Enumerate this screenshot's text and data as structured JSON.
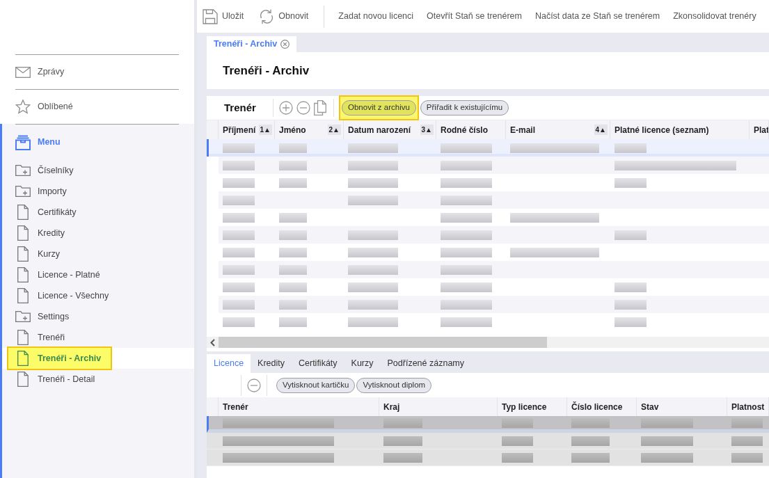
{
  "toolbar": {
    "actions": [
      {
        "kind": "save",
        "label": "Uložit"
      },
      {
        "kind": "refresh",
        "label": "Obnovit"
      }
    ],
    "links": [
      "Zadat novou licenci",
      "Otevřít Staň se trenérem",
      "Načíst data ze Staň se trenérem",
      "Zkonsolidovat trenéry"
    ]
  },
  "sidebar": {
    "top_items": [
      {
        "kind": "mail",
        "label": "Zprávy"
      },
      {
        "kind": "star",
        "label": "Oblíbené"
      }
    ],
    "menu": {
      "label": "Menu",
      "items": [
        {
          "kind": "folder",
          "label": "Číselníky",
          "selected": false,
          "highlighted": false
        },
        {
          "kind": "folder",
          "label": "Importy",
          "selected": false,
          "highlighted": false
        },
        {
          "kind": "document",
          "label": "Certifikáty",
          "selected": false,
          "highlighted": false
        },
        {
          "kind": "document",
          "label": "Kredity",
          "selected": false,
          "highlighted": false
        },
        {
          "kind": "document",
          "label": "Kurzy",
          "selected": false,
          "highlighted": false
        },
        {
          "kind": "document",
          "label": "Licence - Platné",
          "selected": false,
          "highlighted": false
        },
        {
          "kind": "document",
          "label": "Licence - Všechny",
          "selected": false,
          "highlighted": false
        },
        {
          "kind": "folder",
          "label": "Settings",
          "selected": false,
          "highlighted": false
        },
        {
          "kind": "document",
          "label": "Trenéři",
          "selected": false,
          "highlighted": false
        },
        {
          "kind": "document",
          "label": "Trenéři - Archiv",
          "selected": true,
          "highlighted": true
        },
        {
          "kind": "document",
          "label": "Trenéři - Detail",
          "selected": false,
          "highlighted": false
        }
      ]
    }
  },
  "document_tabs": [
    {
      "label": "Trenéři - Archiv",
      "selected": true
    }
  ],
  "page_title": "Trenéři - Archiv",
  "master_grid": {
    "title": "Trenér",
    "buttons": [
      {
        "label": "Obnovit z archivu",
        "highlighted": true
      },
      {
        "label": "Přiřadit k existujícímu",
        "highlighted": false
      }
    ],
    "columns": [
      {
        "label": "Příjmení",
        "sort_badge": "1▲"
      },
      {
        "label": "Jméno",
        "sort_badge": "2▲"
      },
      {
        "label": "Datum narození",
        "sort_badge": "3▲"
      },
      {
        "label": "Rodné číslo"
      },
      {
        "label": "E-mail",
        "sort_badge": "4▲"
      },
      {
        "label": "Platné licence (seznam)"
      },
      {
        "label": "Plat"
      }
    ],
    "rows": [
      {
        "selected": true,
        "cells": [
          {
            "kind": "blurred"
          },
          {
            "kind": "blurred"
          },
          {
            "kind": "blurred"
          },
          {
            "kind": "blurred"
          },
          {
            "kind": "blurred"
          },
          {
            "kind": "blurred"
          },
          {
            "kind": "blank"
          }
        ]
      },
      {
        "selected": false,
        "cells": [
          {
            "kind": "blurred"
          },
          {
            "kind": "blurred"
          },
          {
            "kind": "blurred"
          },
          {
            "kind": "blurred"
          },
          {
            "kind": "blank"
          },
          {
            "kind": "blurred_long"
          },
          {
            "kind": "blank"
          }
        ]
      },
      {
        "selected": false,
        "cells": [
          {
            "kind": "blurred"
          },
          {
            "kind": "blurred"
          },
          {
            "kind": "blurred"
          },
          {
            "kind": "blurred"
          },
          {
            "kind": "blank"
          },
          {
            "kind": "blurred"
          },
          {
            "kind": "blank"
          }
        ]
      },
      {
        "selected": false,
        "cells": [
          {
            "kind": "blurred"
          },
          {
            "kind": "blank"
          },
          {
            "kind": "blurred"
          },
          {
            "kind": "blurred"
          },
          {
            "kind": "blank"
          },
          {
            "kind": "blank"
          },
          {
            "kind": "blank"
          }
        ]
      },
      {
        "selected": false,
        "cells": [
          {
            "kind": "blurred"
          },
          {
            "kind": "blurred"
          },
          {
            "kind": "blank"
          },
          {
            "kind": "blurred"
          },
          {
            "kind": "blurred"
          },
          {
            "kind": "blank"
          },
          {
            "kind": "blank"
          }
        ]
      },
      {
        "selected": false,
        "cells": [
          {
            "kind": "blurred"
          },
          {
            "kind": "blurred"
          },
          {
            "kind": "blurred"
          },
          {
            "kind": "blurred"
          },
          {
            "kind": "blank"
          },
          {
            "kind": "blurred"
          },
          {
            "kind": "blank"
          }
        ]
      },
      {
        "selected": false,
        "cells": [
          {
            "kind": "blurred"
          },
          {
            "kind": "blurred"
          },
          {
            "kind": "blurred"
          },
          {
            "kind": "blurred"
          },
          {
            "kind": "blurred"
          },
          {
            "kind": "blank"
          },
          {
            "kind": "blank"
          }
        ]
      },
      {
        "selected": false,
        "cells": [
          {
            "kind": "blurred"
          },
          {
            "kind": "blurred"
          },
          {
            "kind": "blurred"
          },
          {
            "kind": "blurred"
          },
          {
            "kind": "blank"
          },
          {
            "kind": "blank"
          },
          {
            "kind": "blank"
          }
        ]
      },
      {
        "selected": false,
        "cells": [
          {
            "kind": "blurred"
          },
          {
            "kind": "blurred"
          },
          {
            "kind": "blurred"
          },
          {
            "kind": "blurred"
          },
          {
            "kind": "blank"
          },
          {
            "kind": "blurred"
          },
          {
            "kind": "blank"
          }
        ]
      },
      {
        "selected": false,
        "cells": [
          {
            "kind": "blurred"
          },
          {
            "kind": "blurred"
          },
          {
            "kind": "blurred"
          },
          {
            "kind": "blurred"
          },
          {
            "kind": "blank"
          },
          {
            "kind": "blurred"
          },
          {
            "kind": "blank"
          }
        ]
      },
      {
        "selected": false,
        "cells": [
          {
            "kind": "blurred"
          },
          {
            "kind": "blurred"
          },
          {
            "kind": "blurred"
          },
          {
            "kind": "blurred"
          },
          {
            "kind": "blank"
          },
          {
            "kind": "blurred"
          },
          {
            "kind": "blank"
          }
        ]
      }
    ]
  },
  "detail_tabs": [
    {
      "label": "Licence",
      "selected": true
    },
    {
      "label": "Kredity",
      "selected": false
    },
    {
      "label": "Certifikáty",
      "selected": false
    },
    {
      "label": "Kurzy",
      "selected": false
    },
    {
      "label": "Podřízené záznamy",
      "selected": false
    }
  ],
  "detail_grid": {
    "buttons": [
      {
        "label": "Vytisknout kartičku",
        "highlighted": false
      },
      {
        "label": "Vytisknout diplom",
        "highlighted": false
      }
    ],
    "columns": [
      {
        "label": "Trenér"
      },
      {
        "label": "Kraj"
      },
      {
        "label": "Typ licence"
      },
      {
        "label": "Číslo licence"
      },
      {
        "label": "Stav"
      },
      {
        "label": "Platnost"
      }
    ],
    "rows": [
      {
        "selected": true,
        "cells": [
          {
            "kind": "blurred"
          },
          {
            "kind": "blurred"
          },
          {
            "kind": "blurred"
          },
          {
            "kind": "blurred"
          },
          {
            "kind": "blurred"
          },
          {
            "kind": "blurred"
          }
        ]
      },
      {
        "selected": false,
        "cells": [
          {
            "kind": "blurred"
          },
          {
            "kind": "blurred"
          },
          {
            "kind": "blurred"
          },
          {
            "kind": "blurred"
          },
          {
            "kind": "blurred"
          },
          {
            "kind": "blurred"
          }
        ]
      },
      {
        "selected": false,
        "cells": [
          {
            "kind": "blurred"
          },
          {
            "kind": "blurred"
          },
          {
            "kind": "blurred"
          },
          {
            "kind": "blurred"
          },
          {
            "kind": "blurred"
          },
          {
            "kind": "blurred"
          }
        ]
      }
    ]
  }
}
